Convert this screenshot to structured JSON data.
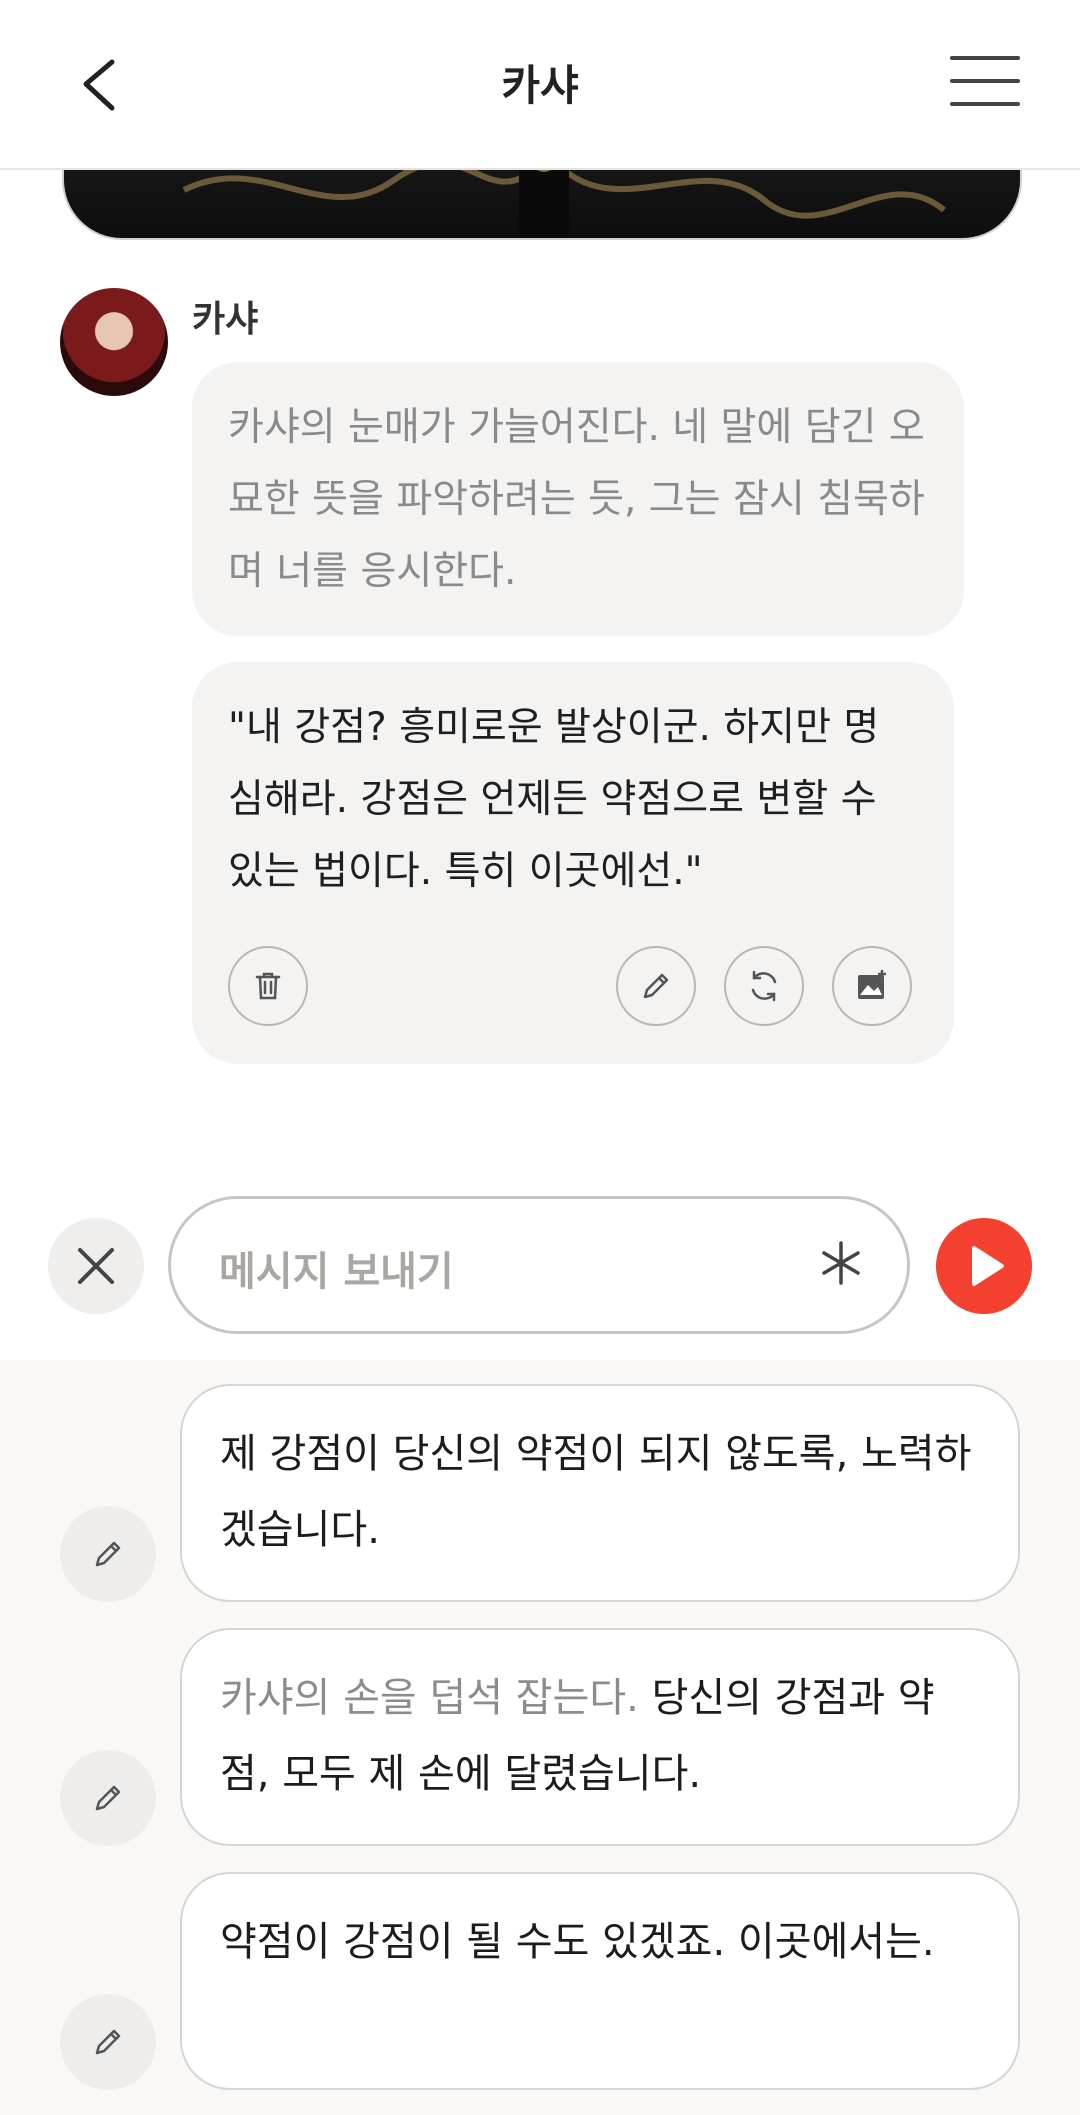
{
  "header": {
    "title": "카샤"
  },
  "character": {
    "name": "카샤"
  },
  "messages": {
    "narration": "카샤의 눈매가 가늘어진다. 네 말에 담긴 오묘한 뜻을 파악하려는 듯, 그는 잠시 침묵하며 너를 응시한다.",
    "speech": "\"내 강점? 흥미로운 발상이군. 하지만 명심해라. 강점은 언제든 약점으로 변할 수 있는 법이다. 특히 이곳에선.\""
  },
  "input": {
    "placeholder": "메시지 보내기"
  },
  "suggestions": [
    {
      "narration": "",
      "text": "제 강점이 당신의 약점이 되지 않도록, 노력하겠습니다."
    },
    {
      "narration": "카샤의 손을 덥석 잡는다.",
      "text": " 당신의 강점과 약점, 모두 제 손에 달렸습니다."
    },
    {
      "narration": "",
      "text": "약점이 강점이 될 수도 있겠죠. 이곳에서는."
    }
  ],
  "colors": {
    "accent": "#f4402f",
    "bubble": "#f4f3f1",
    "narration_text": "#8a8a8a"
  },
  "icons": [
    "back-icon",
    "menu-icon",
    "trash-icon",
    "pencil-icon",
    "refresh-icon",
    "image-add-icon",
    "close-icon",
    "asterisk-icon",
    "play-icon"
  ]
}
